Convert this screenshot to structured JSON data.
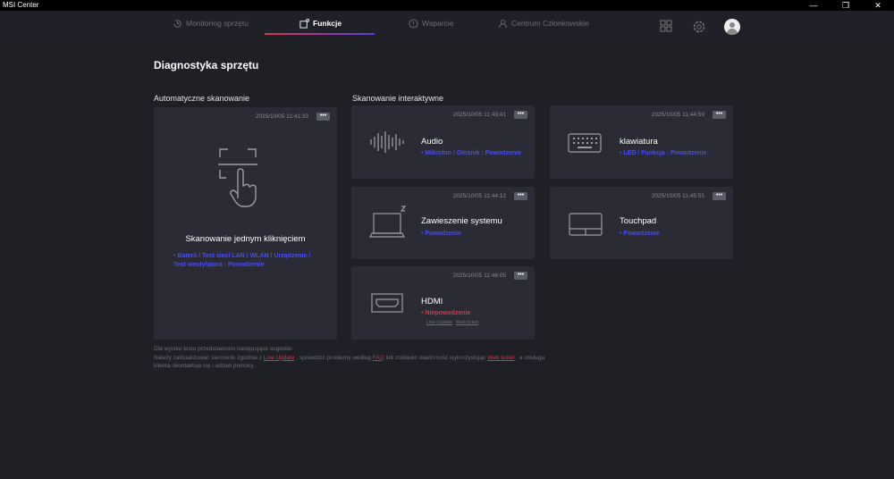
{
  "window": {
    "title": "MSI Center",
    "min": "—",
    "restore": "❐",
    "close": "✕"
  },
  "nav": {
    "tabs": [
      {
        "label": "Monitoring sprzętu"
      },
      {
        "label": "Funkcje"
      },
      {
        "label": "Wsparcie"
      },
      {
        "label": "Centrum Członkowskie"
      }
    ]
  },
  "page": {
    "title": "Diagnostyka sprzętu",
    "auto_section": "Automatyczne skanowanie",
    "interactive_section": "Skanowanie interaktywne"
  },
  "auto_card": {
    "timestamp": "2025/10/05  11:41:33",
    "title": "Skanowanie jednym kliknięciem",
    "status": "• Baterii / Test sieci LAN / WLAN / Urządzenie / Test wentylatora : Powodzenie"
  },
  "cards": [
    {
      "timestamp": "2025/10/05  11:43:41",
      "title": "Audio",
      "status": "• Mikrofon / Głośnik : Powodzenie"
    },
    {
      "timestamp": "2025/10/05  11:44:59",
      "title": "klawiatura",
      "status": "• LED / Funkcja : Powodzenie"
    },
    {
      "timestamp": "2025/10/05  11:44:12",
      "title": "Zawieszenie systemu",
      "status": "• Powodzenie"
    },
    {
      "timestamp": "2025/10/05  11:45:55",
      "title": "Touchpad",
      "status": "• Powodzenie"
    },
    {
      "timestamp": "2025/10/05  11:46:05",
      "title": "HDMI",
      "status": "• Niepowodzenie",
      "link1": "Live Update",
      "link2": "Web ticket"
    }
  ],
  "more_label": "•••",
  "note": {
    "line1": "Dla wyniku testu przedstawiono następujące sugestie:",
    "p1": "Należy zaktualizować sterownik zgodnie z ",
    "live_update": "Live Update",
    "p2": " , sprawdzić problemy według ",
    "faq": "FAQ",
    "p3": " lub zostawić wiadomość wykorzystując ",
    "web_ticket": "Web ticket",
    "p4": " , a obsługa klienta skontaktuje się i udzieli pomocy."
  }
}
